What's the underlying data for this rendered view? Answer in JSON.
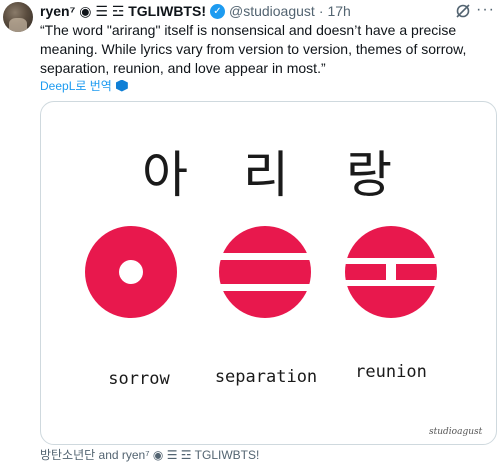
{
  "tweet": {
    "name": "ryen⁷ ◉ ☰ ☲ TGLIWBTS!",
    "handle": "@studioagust",
    "separator": "·",
    "time": "17h",
    "text": "“The word \"arirang\" itself is nonsensical and doesn’t have a precise meaning. While lyrics vary from version to version, themes of sorrow, separation, reunion, and love appear in most.”",
    "translate_label": "DeepL로 번역"
  },
  "image": {
    "korean": [
      "아",
      "리",
      "랑"
    ],
    "labels": [
      "sorrow",
      "separation",
      "reunion"
    ],
    "watermark": "studioagust",
    "accent_color": "#e8184d"
  },
  "footer": {
    "likes_text": "방탄소년단 and ryen⁷ ◉ ☰ ☲ TGLIWBTS!"
  },
  "icons": [
    "avatar",
    "verified-badge-icon",
    "grok-icon",
    "more-icon",
    "translate-icon"
  ]
}
